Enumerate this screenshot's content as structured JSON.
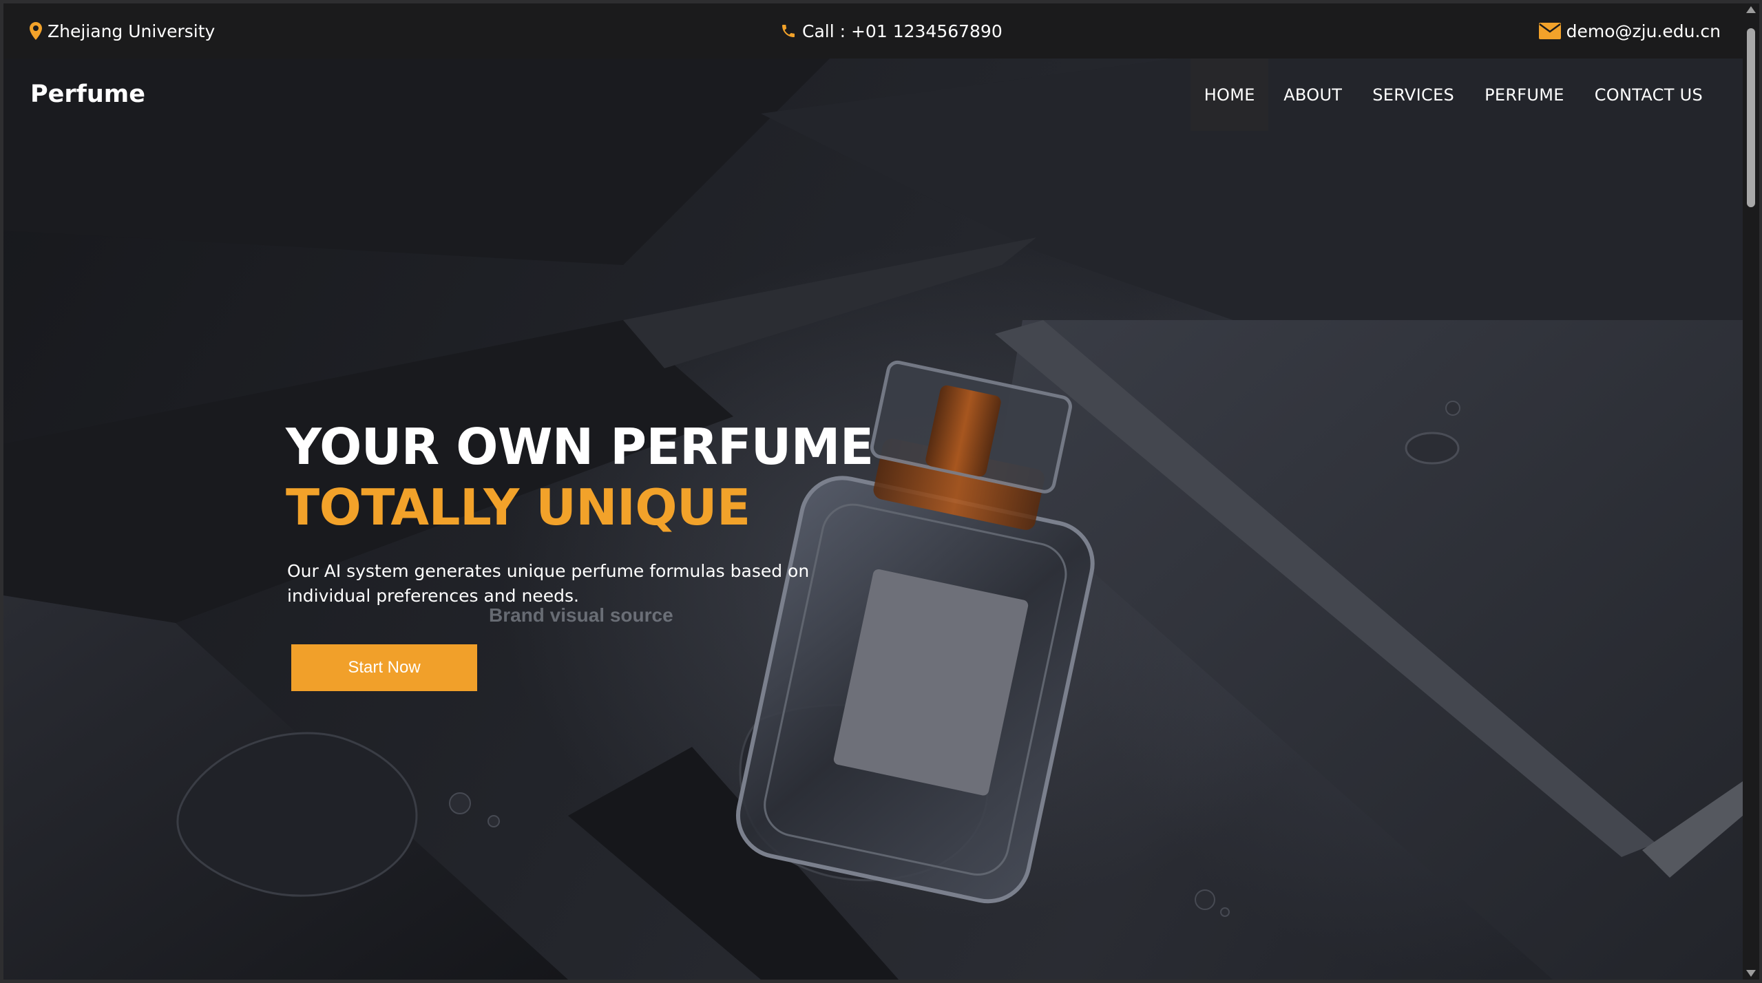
{
  "topbar": {
    "location": "Zhejiang University",
    "location_icon": "map-pin-icon",
    "phone": "Call : +01 1234567890",
    "phone_icon": "phone-icon",
    "email": "demo@zju.edu.cn",
    "email_icon": "envelope-icon"
  },
  "brand": "Perfume",
  "nav": {
    "items": [
      {
        "label": "HOME",
        "active": true
      },
      {
        "label": "ABOUT",
        "active": false
      },
      {
        "label": "SERVICES",
        "active": false
      },
      {
        "label": "PERFUME",
        "active": false
      },
      {
        "label": "CONTACT US",
        "active": false
      }
    ]
  },
  "hero": {
    "title_line1": "YOUR OWN PERFUME",
    "title_line2": "TOTALLY UNIQUE",
    "description": "Our AI system generates unique perfume formulas based on individual preferences and needs.",
    "cta_label": "Start Now",
    "watermark_title": "Brand visual source",
    "watermark_text": "Brand visual source"
  },
  "colors": {
    "accent": "#f2a22a",
    "topbar_bg": "#1b1b1c",
    "text": "#ffffff"
  }
}
